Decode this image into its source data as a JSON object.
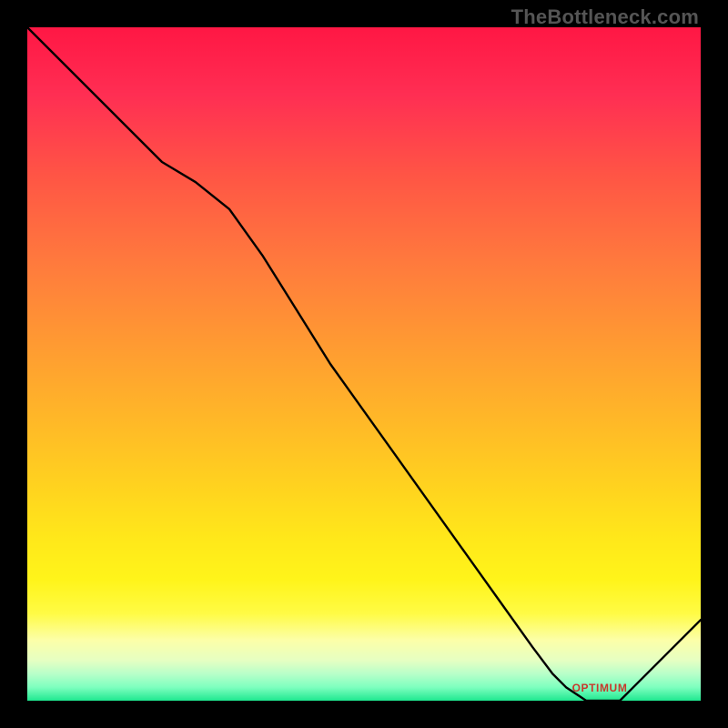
{
  "watermark": "TheBottleneck.com",
  "colors": {
    "frame": "#000000",
    "curve": "#000000",
    "annotation": "#c8382c",
    "gradient_top": "#ff1744",
    "gradient_bottom": "#1fe890"
  },
  "chart_data": {
    "type": "line",
    "title": "",
    "xlabel": "",
    "ylabel": "",
    "xlim": [
      0,
      100
    ],
    "ylim": [
      0,
      100
    ],
    "x": [
      0,
      5,
      10,
      15,
      20,
      25,
      30,
      35,
      40,
      45,
      50,
      55,
      60,
      65,
      70,
      75,
      78,
      80,
      83,
      86,
      88,
      90,
      95,
      100
    ],
    "values": [
      100,
      95,
      90,
      85,
      80,
      77,
      73,
      66,
      58,
      50,
      43,
      36,
      29,
      22,
      15,
      8,
      4,
      2,
      0,
      0,
      0,
      2,
      7,
      12
    ],
    "annotation": {
      "text": "OPTIMUM",
      "x": 85,
      "y": 1
    }
  }
}
